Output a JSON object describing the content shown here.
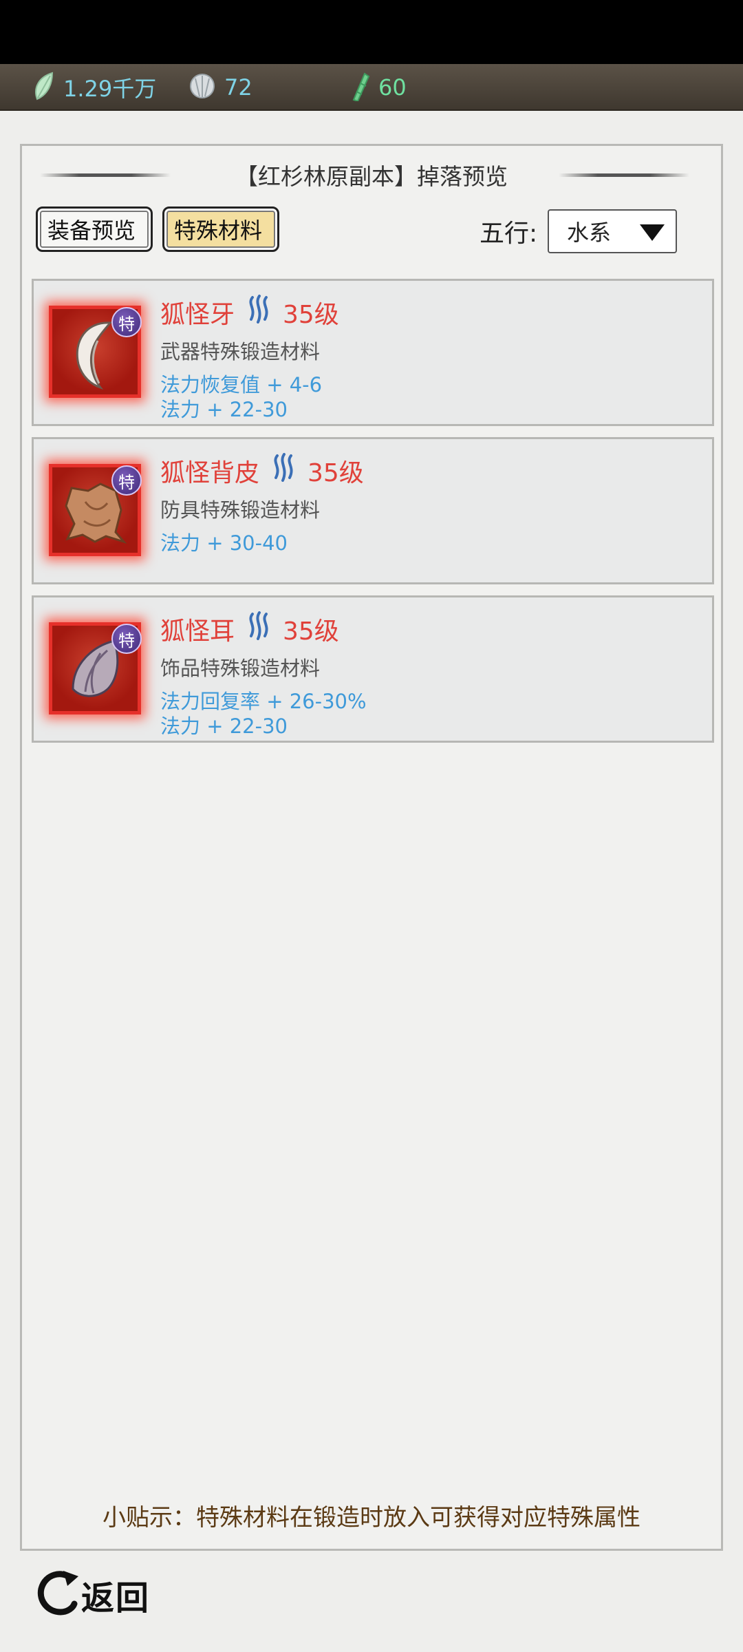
{
  "resources": {
    "jade": {
      "icon": "jade-leaf-icon",
      "value": "1.29千万"
    },
    "shell": {
      "icon": "shell-icon",
      "value": "72"
    },
    "bamboo": {
      "icon": "bamboo-icon",
      "value": "60"
    }
  },
  "panel": {
    "title": "【红杉林原副本】掉落预览",
    "tabs": {
      "equip": "装备预览",
      "special": "特殊材料"
    },
    "wuxing_label": "五行:",
    "wuxing_selected": "水系"
  },
  "items": [
    {
      "name": "狐怪牙",
      "element_icon": "water-element-icon",
      "level": "35级",
      "badge": "特",
      "desc": "武器特殊锻造材料",
      "stats": [
        "法力恢复值 + 4-6",
        "法力 + 22-30"
      ]
    },
    {
      "name": "狐怪背皮",
      "element_icon": "water-element-icon",
      "level": "35级",
      "badge": "特",
      "desc": "防具特殊锻造材料",
      "stats": [
        "法力 + 30-40"
      ]
    },
    {
      "name": "狐怪耳",
      "element_icon": "water-element-icon",
      "level": "35级",
      "badge": "特",
      "desc": "饰品特殊锻造材料",
      "stats": [
        "法力回复率 + 26-30%",
        "法力 + 22-30"
      ]
    }
  ],
  "tip": "小贴示：特殊材料在锻造时放入可获得对应特殊属性",
  "back_label": "返回",
  "colors": {
    "name": "#e0413a",
    "stat": "#3f9ad9",
    "tip": "#5b3a14",
    "tab_active": "#f4dfa0"
  }
}
